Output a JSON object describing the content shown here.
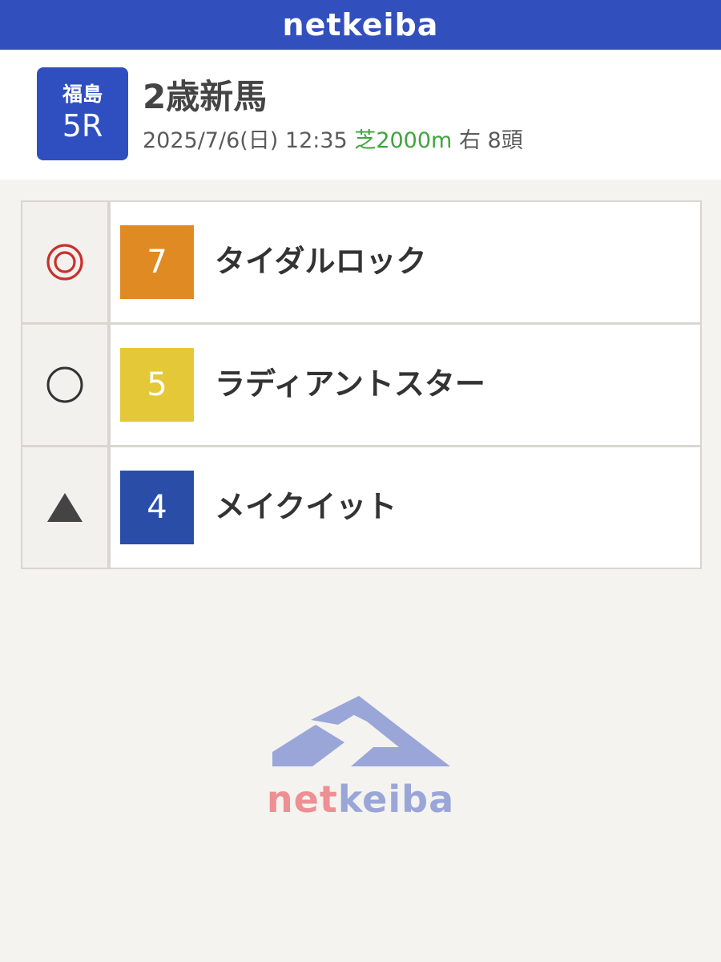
{
  "header": {
    "logo": "netkeiba"
  },
  "race": {
    "venue": "福島",
    "number": "5R",
    "title": "2歳新馬",
    "date_time": "2025/7/6(日) 12:35",
    "course": "芝2000m",
    "direction_count": "右 8頭"
  },
  "picks": [
    {
      "mark": "◎",
      "mark_icon": "double-circle-icon",
      "number": "7",
      "color": "#e08a24",
      "name": "タイダルロック"
    },
    {
      "mark": "○",
      "mark_icon": "circle-icon",
      "number": "5",
      "color": "#e5c838",
      "name": "ラディアントスター"
    },
    {
      "mark": "▲",
      "mark_icon": "triangle-icon",
      "number": "4",
      "color": "#2a4ea8",
      "name": "メイクイット"
    }
  ],
  "footer": {
    "logo_part1": "net",
    "logo_part2": "keiba"
  },
  "colors": {
    "brand": "#3150bd",
    "course": "#3fa53d",
    "mark_red": "#c9302c"
  }
}
